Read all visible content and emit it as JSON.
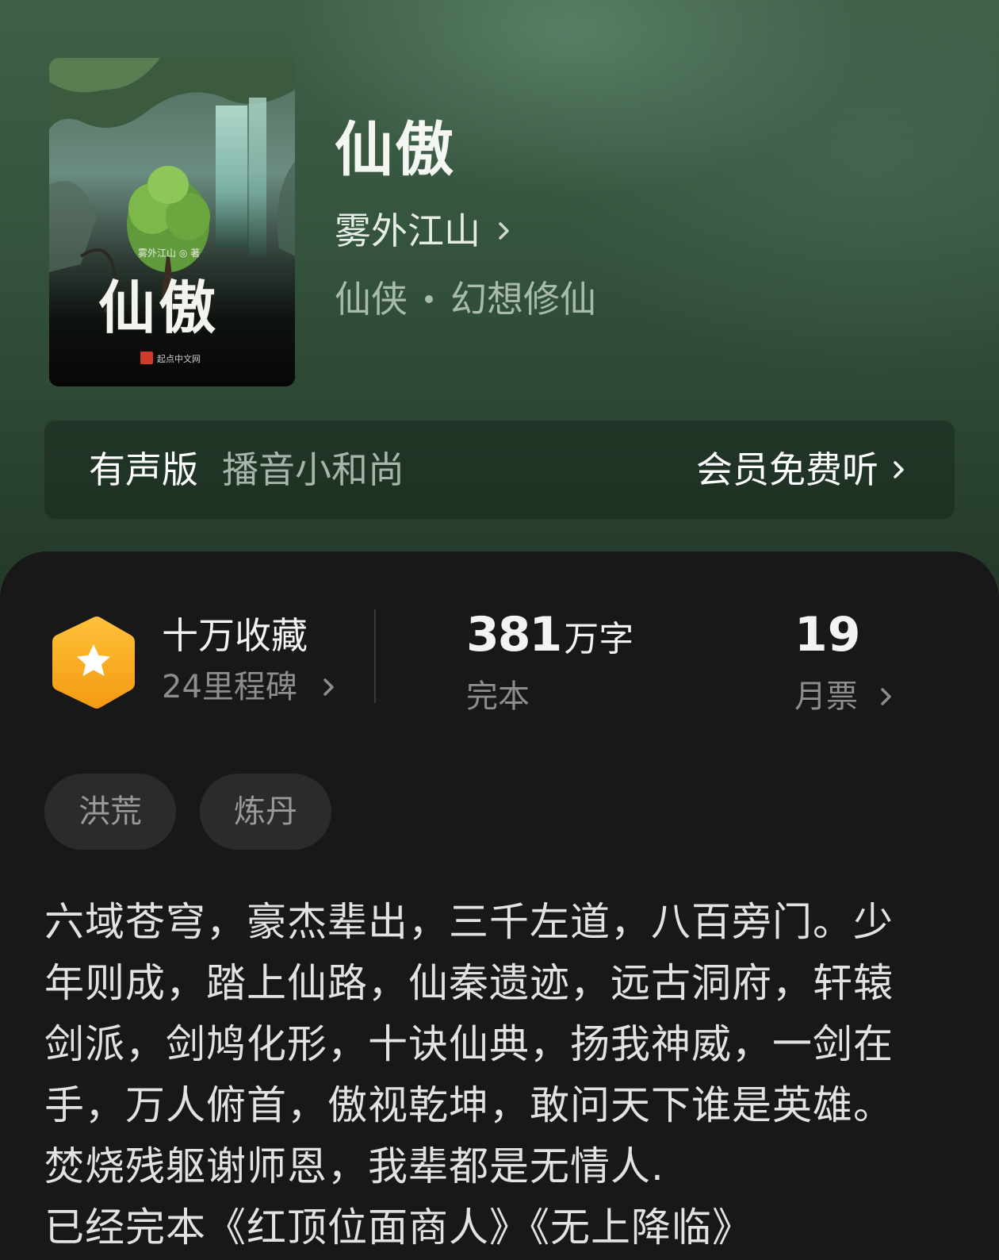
{
  "book": {
    "title": "仙傲",
    "author": "雾外江山",
    "category": "仙侠",
    "subcategory": "幻想修仙"
  },
  "cover": {
    "author_line": "雾外江山 ◎ 著",
    "title_calligraphy": "仙傲",
    "publisher": "起点中文网"
  },
  "audio": {
    "label": "有声版",
    "narrator": "播音小和尚",
    "cta": "会员免费听"
  },
  "stats": {
    "favorites": "十万收藏",
    "milestones": "24里程碑",
    "word_count": "381",
    "word_unit": "万字",
    "status": "完本",
    "monthly_votes": "19",
    "monthly_votes_label": "月票"
  },
  "tags": [
    "洪荒",
    "炼丹"
  ],
  "description": "六域苍穹，豪杰辈出，三千左道，八百旁门。少\n年则成，踏上仙路，仙秦遗迹，远古洞府，轩辕\n剑派，剑鸠化形，十诀仙典，扬我神威，一剑在\n手，万人俯首，傲视乾坤，敢问天下谁是英雄。\n焚烧残躯谢师恩，我辈都是无情人.\n已经完本《红顶位面商人》《无上降临》",
  "colors": {
    "hero_bg": "#36553f",
    "panel_bg": "#181818",
    "badge": "#f7a619",
    "secondary_text": "#8d8d8d"
  }
}
